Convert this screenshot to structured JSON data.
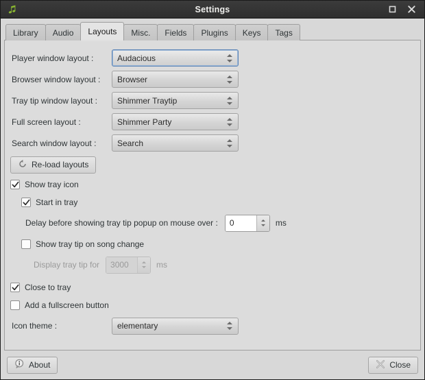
{
  "window": {
    "title": "Settings",
    "app_icon": "music-note-icon",
    "controls": [
      {
        "name": "maximize-button",
        "glyph": "maximize-icon"
      },
      {
        "name": "close-button",
        "glyph": "close-icon"
      }
    ]
  },
  "tabs": [
    {
      "label": "Library",
      "active": false
    },
    {
      "label": "Audio",
      "active": false
    },
    {
      "label": "Layouts",
      "active": true
    },
    {
      "label": "Misc.",
      "active": false
    },
    {
      "label": "Fields",
      "active": false
    },
    {
      "label": "Plugins",
      "active": false
    },
    {
      "label": "Keys",
      "active": false
    },
    {
      "label": "Tags",
      "active": false
    }
  ],
  "layouts": {
    "player_window": {
      "label": "Player window layout :",
      "value": "Audacious"
    },
    "browser_window": {
      "label": "Browser window layout :",
      "value": "Browser"
    },
    "traytip_window": {
      "label": "Tray tip window layout :",
      "value": "Shimmer Traytip"
    },
    "fullscreen": {
      "label": "Full screen layout :",
      "value": "Shimmer Party"
    },
    "search_window": {
      "label": "Search window layout :",
      "value": "Search"
    },
    "reload_button": "Re-load layouts",
    "show_tray_icon": {
      "label": "Show tray icon",
      "checked": true
    },
    "start_in_tray": {
      "label": "Start in tray",
      "checked": true
    },
    "delay_traytip": {
      "label": "Delay before showing tray tip popup on mouse over :",
      "value": "0",
      "unit": "ms"
    },
    "show_traytip_on_song_change": {
      "label": "Show tray tip on song change",
      "checked": false
    },
    "display_traytip_for": {
      "label": "Display tray tip for",
      "value": "3000",
      "unit": "ms",
      "enabled": false
    },
    "close_to_tray": {
      "label": "Close to tray",
      "checked": true
    },
    "add_fullscreen_button": {
      "label": "Add a fullscreen button",
      "checked": false
    },
    "icon_theme": {
      "label": "Icon theme :",
      "value": "elementary"
    }
  },
  "actions": {
    "about": "About",
    "close": "Close"
  },
  "colors": {
    "titlebar": "#333333",
    "window_bg": "#d8d8d8",
    "page_bg": "#dcdcdc",
    "focus_border": "#5a83b5",
    "app_icon_green": "#8bb830",
    "text": "#2e3436",
    "text_disabled": "#9a9a9a"
  }
}
